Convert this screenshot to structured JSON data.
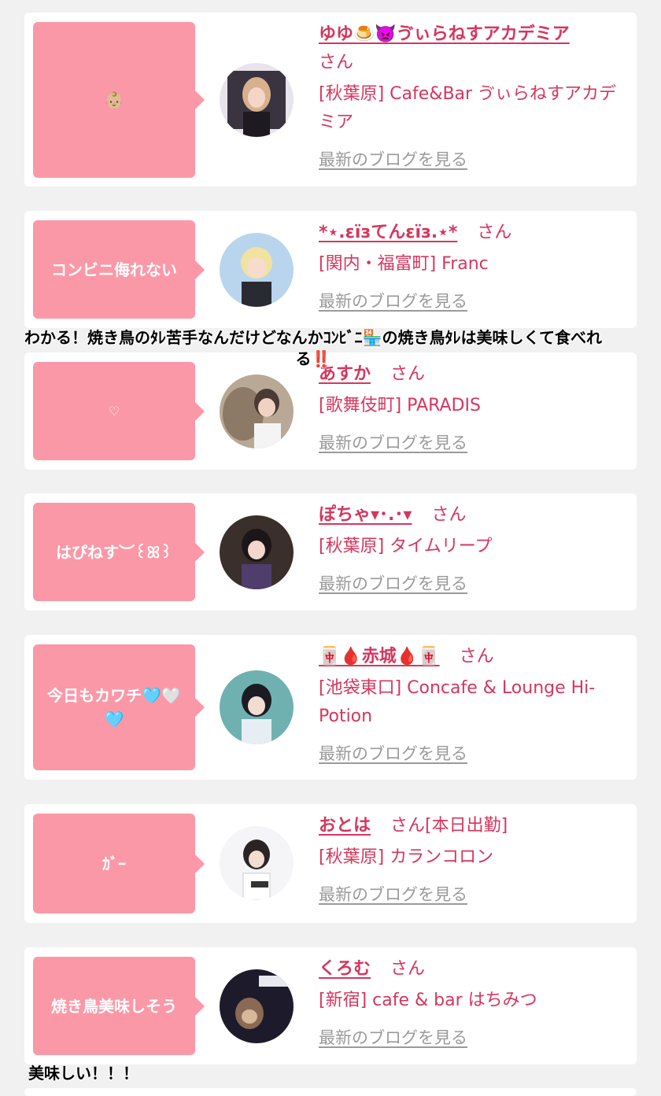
{
  "blog_link_label": "最新のブログを見る",
  "san_label": "さん",
  "cards": [
    {
      "comment": "👶🏼",
      "name": "ゆゆ🍮👿ゔぃらねすアカデミア",
      "badge": "",
      "shop": "[秋葉原] Cafe&Bar ゔぃらねすアカデミア"
    },
    {
      "comment": "コンビニ侮れない",
      "name": "*⋆.εïзてんεïз.⋆*",
      "badge": "",
      "shop": "[関内・福富町] Franc"
    },
    {
      "comment": "♡",
      "name": "あすか",
      "badge": "",
      "shop": "[歌舞伎町] PARADIS"
    },
    {
      "comment": "はぴねす︶꒰ꕤ꒱",
      "name": "ぽちゃ▾･.･▾",
      "badge": "",
      "shop": "[秋葉原] タイムリープ"
    },
    {
      "comment": "今日もカワチ🩵🤍🩵",
      "name": "🀄🩸赤城🩸🀄",
      "badge": "",
      "shop": "[池袋東口] Concafe & Lounge Hi-Potion"
    },
    {
      "comment": "ｶﾞｰ",
      "name": "おとは",
      "badge": "[本日出勤]",
      "shop": "[秋葉原] カランコロン"
    },
    {
      "comment": "焼き鳥美味しそう",
      "name": "くろむ",
      "badge": "",
      "shop": "[新宿] cafe & bar はちみつ"
    }
  ],
  "overlay_comments": [
    "わかる！焼き鳥のﾀﾚ苦手なんだけどなんかｺﾝﾋﾞﾆ🏪の焼き鳥ﾀﾚは美味しくて食べれる‼️",
    "美味しい！！！"
  ],
  "colors": {
    "background": "#f1f1f1",
    "card": "#ffffff",
    "bubble": "#fb98a7",
    "accent": "#d6365d",
    "link_gray": "#9a9a9a"
  }
}
